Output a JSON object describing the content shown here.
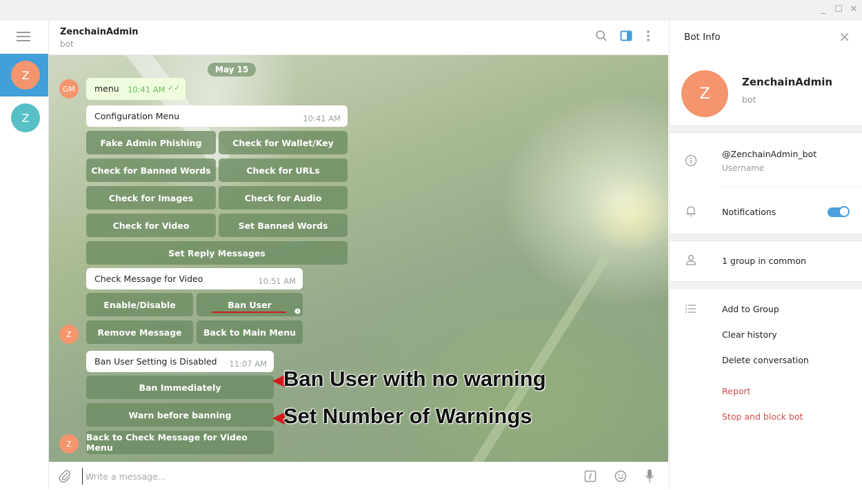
{
  "window": {
    "minimize": "_",
    "maximize": "☐",
    "close": "✕"
  },
  "chat_list": [
    {
      "initial": "Z",
      "active": true,
      "color": "#f4956e"
    },
    {
      "initial": "Z",
      "active": false,
      "color": "#56c0c6"
    }
  ],
  "header": {
    "title": "ZenchainAdmin",
    "subtitle": "bot"
  },
  "messages": {
    "date": "May 15",
    "menu_avatar": "GM",
    "menu_text": "menu",
    "menu_time": "10:41 AM",
    "menu_check": "✓✓",
    "config_title": "Configuration Menu",
    "config_time": "10:41 AM",
    "config_buttons": [
      "Fake Admin Phishing",
      "Check for Wallet/Key",
      "Check for Banned Words",
      "Check for URLs",
      "Check for Images",
      "Check for Audio",
      "Check for Video",
      "Set Banned Words",
      "Set Reply Messages"
    ],
    "video_title": "Check Message for Video",
    "video_time": "10:51 AM",
    "video_buttons": [
      "Enable/Disable",
      "Ban User",
      "Remove Message",
      "Back to Main Menu"
    ],
    "bot_avatar": "Z",
    "ban_title": "Ban User Setting is Disabled",
    "ban_time": "11:07 AM",
    "ban_buttons": [
      "Ban Immediately",
      "Warn before banning",
      "Back to Check Message for Video Menu"
    ]
  },
  "annotations": {
    "first": "Ban User with no warning",
    "second": "Set Number of Warnings",
    "arrow_color": "#d21c1c"
  },
  "compose": {
    "placeholder": "Write a message..."
  },
  "bot_info": {
    "title": "Bot Info",
    "name": "ZenchainAdmin",
    "status": "bot",
    "avatar_initial": "Z",
    "username": "@ZenchainAdmin_bot",
    "username_label": "Username",
    "notifications_label": "Notifications",
    "notifications_on": true,
    "groups_in_common": "1 group in common",
    "actions": [
      "Add to Group",
      "Clear history",
      "Delete conversation"
    ],
    "danger_actions": [
      "Report",
      "Stop and block bot"
    ]
  },
  "colors": {
    "accent": "#419fd9",
    "avatar_orange": "#f4956e",
    "avatar_teal": "#56c0c6",
    "danger": "#d14e4e"
  }
}
